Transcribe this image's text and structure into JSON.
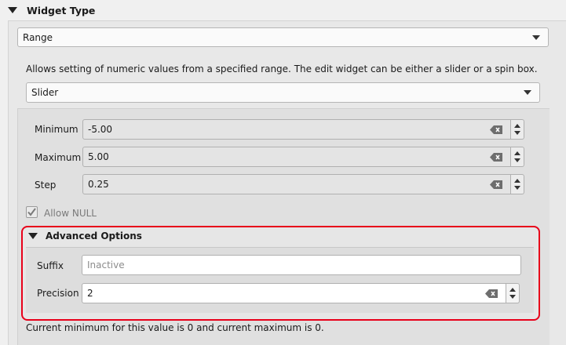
{
  "widget_type": {
    "section_title": "Widget Type",
    "selected": "Range"
  },
  "range": {
    "description": "Allows setting of numeric values from a specified range. The edit widget can be either a slider or a spin box.",
    "edit_widget": "Slider",
    "minimum": {
      "label": "Minimum",
      "value": "-5.00"
    },
    "maximum": {
      "label": "Maximum",
      "value": "5.00"
    },
    "step": {
      "label": "Step",
      "value": "0.25"
    },
    "allow_null": {
      "label": "Allow NULL",
      "checked": true
    }
  },
  "advanced": {
    "title": "Advanced Options",
    "suffix": {
      "label": "Suffix",
      "placeholder": "Inactive",
      "value": ""
    },
    "precision": {
      "label": "Precision",
      "value": "2"
    }
  },
  "footer": {
    "info": "Current minimum for this value is 0 and current maximum is 0."
  },
  "colors": {
    "highlight_border": "#e8001a"
  },
  "icons": {
    "section_toggle": "triangle-down-icon",
    "combo_arrow": "chevron-down-icon",
    "clear": "clear-text-icon",
    "spin_up": "arrow-up-icon",
    "spin_down": "arrow-down-icon",
    "check": "checkmark-icon"
  }
}
